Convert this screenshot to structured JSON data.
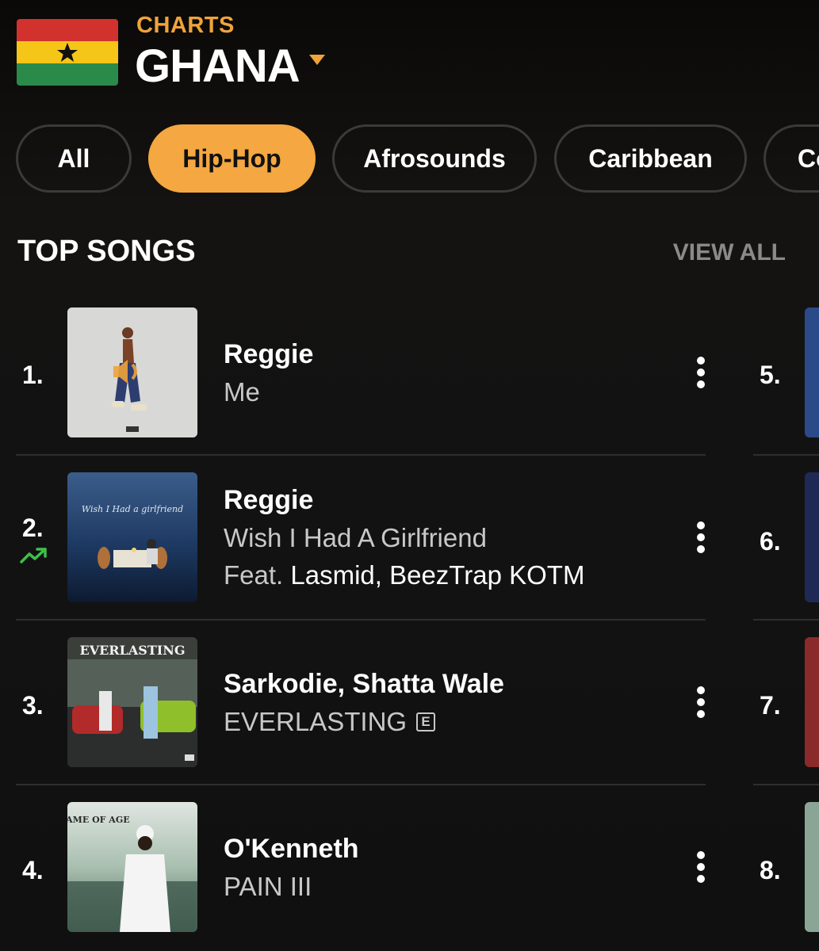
{
  "header": {
    "section_label": "CHARTS",
    "country": "GHANA"
  },
  "genres": [
    {
      "label": "All",
      "active": false
    },
    {
      "label": "Hip-Hop",
      "active": true
    },
    {
      "label": "Afrosounds",
      "active": false
    },
    {
      "label": "Caribbean",
      "active": false
    },
    {
      "label": "Co",
      "active": false
    }
  ],
  "top_songs": {
    "title": "TOP SONGS",
    "view_all": "VIEW ALL",
    "songs": [
      {
        "rank": "1.",
        "artist": "Reggie",
        "title": "Me"
      },
      {
        "rank": "2.",
        "artist": "Reggie",
        "title": "Wish I Had A Girlfriend",
        "feat_label": "Feat.",
        "feat_artists": "Lasmid, BeezTrap KOTM",
        "trend": "up"
      },
      {
        "rank": "3.",
        "artist": "Sarkodie, Shatta Wale",
        "title": "EVERLASTING",
        "explicit": "E"
      },
      {
        "rank": "4.",
        "artist": "O'Kenneth",
        "title": "PAIN III"
      }
    ],
    "next_column_ranks": [
      "5.",
      "6.",
      "7.",
      "8."
    ]
  },
  "artwork_text": {
    "song2_cover": "Wish I Had a girlfriend",
    "song3_cover": "EVERLASTING",
    "song4_cover": "CAME OF AGE"
  },
  "colors": {
    "accent": "#f5a742",
    "trend_up": "#3fbf4a",
    "background": "#121212"
  },
  "icons": {
    "more": "vertical-ellipsis",
    "trend": "trending-up",
    "speaker": "speaker-icon"
  }
}
